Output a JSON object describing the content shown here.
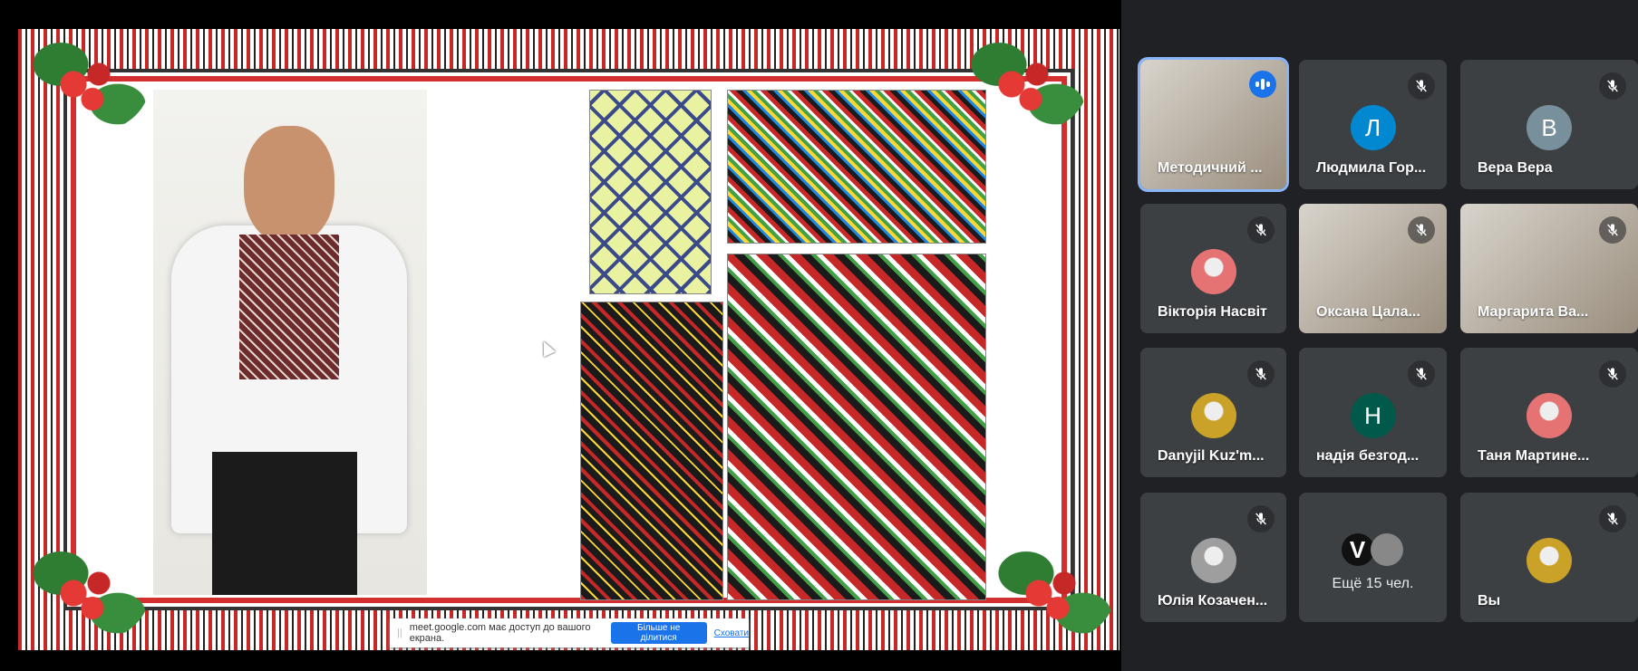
{
  "share_bar": {
    "message": "meet.google.com має доступ до вашого екрана.",
    "stop_label": "Більше не ділитися",
    "hide_label": "Сховати"
  },
  "participants": [
    {
      "name": "Методичний ...",
      "type": "video",
      "speaking": true
    },
    {
      "name": "Людмила Гор...",
      "initial": "Л",
      "color": "#0288d1",
      "muted": true
    },
    {
      "name": "Вера Вера",
      "initial": "В",
      "color": "#78909c",
      "muted": true
    },
    {
      "name": "Вікторія Насвіт",
      "type": "photo-avatar",
      "muted": true
    },
    {
      "name": "Оксана Цала...",
      "type": "video",
      "muted": true
    },
    {
      "name": "Маргарита Ва...",
      "type": "video",
      "muted": true
    },
    {
      "name": "Danyjil Kuz'm...",
      "type": "photo-avatar",
      "muted": true
    },
    {
      "name": "надія безгод...",
      "initial": "Н",
      "color": "#00594a",
      "muted": true
    },
    {
      "name": "Таня Мартине...",
      "type": "photo-avatar",
      "muted": true
    },
    {
      "name": "Юлія Козачен...",
      "type": "photo-avatar",
      "muted": true
    },
    {
      "more_label": "Ещё 15 чел.",
      "initial": "V"
    },
    {
      "name": "Вы",
      "type": "photo-avatar",
      "muted": true
    }
  ]
}
